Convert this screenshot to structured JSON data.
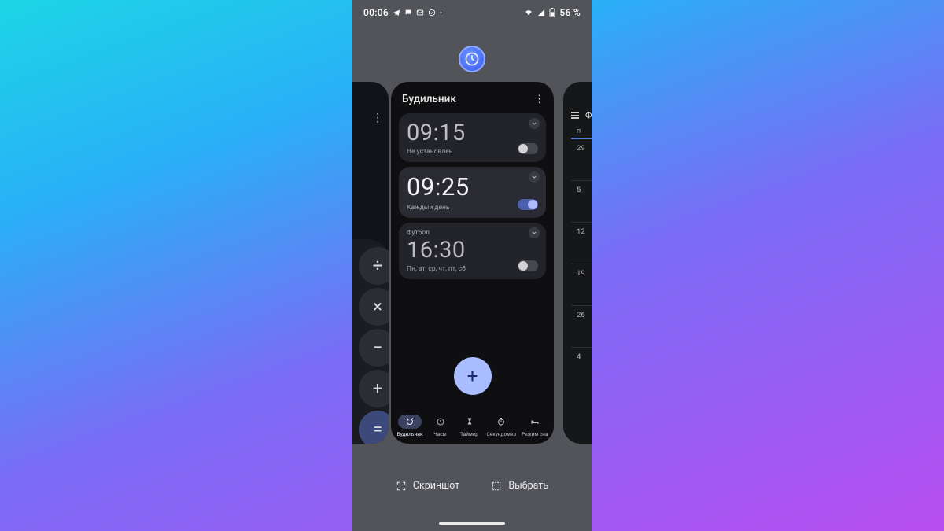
{
  "status": {
    "time": "00:06",
    "battery_text": "56 %"
  },
  "app_icon": "clock-app",
  "clock_app": {
    "title": "Будильник",
    "alarms": [
      {
        "time": "09:15",
        "subtitle": "Не установлен",
        "enabled": false,
        "label": ""
      },
      {
        "time": "09:25",
        "subtitle": "Каждый день",
        "enabled": true,
        "label": ""
      },
      {
        "time": "16:30",
        "subtitle": "Пн, вт, ср, чт, пт, сб",
        "enabled": false,
        "label": "Футбол"
      }
    ],
    "nav": {
      "items": [
        {
          "label": "Будильник"
        },
        {
          "label": "Часы"
        },
        {
          "label": "Таймер"
        },
        {
          "label": "Секундомер"
        },
        {
          "label": "Режим сна"
        }
      ]
    },
    "fab_label": "+"
  },
  "calendar_peek": {
    "letter": "Ф",
    "day_header": "п",
    "days": [
      "29",
      "5",
      "12",
      "19",
      "26",
      "4"
    ]
  },
  "recents_actions": {
    "screenshot": "Скриншот",
    "select": "Выбрать"
  }
}
